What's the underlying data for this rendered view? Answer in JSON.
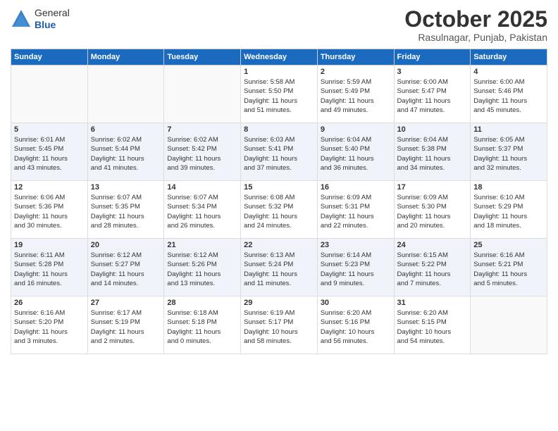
{
  "header": {
    "logo_general": "General",
    "logo_blue": "Blue",
    "month": "October 2025",
    "location": "Rasulnagar, Punjab, Pakistan"
  },
  "days_of_week": [
    "Sunday",
    "Monday",
    "Tuesday",
    "Wednesday",
    "Thursday",
    "Friday",
    "Saturday"
  ],
  "weeks": [
    [
      {
        "day": "",
        "info": ""
      },
      {
        "day": "",
        "info": ""
      },
      {
        "day": "",
        "info": ""
      },
      {
        "day": "1",
        "info": "Sunrise: 5:58 AM\nSunset: 5:50 PM\nDaylight: 11 hours\nand 51 minutes."
      },
      {
        "day": "2",
        "info": "Sunrise: 5:59 AM\nSunset: 5:49 PM\nDaylight: 11 hours\nand 49 minutes."
      },
      {
        "day": "3",
        "info": "Sunrise: 6:00 AM\nSunset: 5:47 PM\nDaylight: 11 hours\nand 47 minutes."
      },
      {
        "day": "4",
        "info": "Sunrise: 6:00 AM\nSunset: 5:46 PM\nDaylight: 11 hours\nand 45 minutes."
      }
    ],
    [
      {
        "day": "5",
        "info": "Sunrise: 6:01 AM\nSunset: 5:45 PM\nDaylight: 11 hours\nand 43 minutes."
      },
      {
        "day": "6",
        "info": "Sunrise: 6:02 AM\nSunset: 5:44 PM\nDaylight: 11 hours\nand 41 minutes."
      },
      {
        "day": "7",
        "info": "Sunrise: 6:02 AM\nSunset: 5:42 PM\nDaylight: 11 hours\nand 39 minutes."
      },
      {
        "day": "8",
        "info": "Sunrise: 6:03 AM\nSunset: 5:41 PM\nDaylight: 11 hours\nand 37 minutes."
      },
      {
        "day": "9",
        "info": "Sunrise: 6:04 AM\nSunset: 5:40 PM\nDaylight: 11 hours\nand 36 minutes."
      },
      {
        "day": "10",
        "info": "Sunrise: 6:04 AM\nSunset: 5:38 PM\nDaylight: 11 hours\nand 34 minutes."
      },
      {
        "day": "11",
        "info": "Sunrise: 6:05 AM\nSunset: 5:37 PM\nDaylight: 11 hours\nand 32 minutes."
      }
    ],
    [
      {
        "day": "12",
        "info": "Sunrise: 6:06 AM\nSunset: 5:36 PM\nDaylight: 11 hours\nand 30 minutes."
      },
      {
        "day": "13",
        "info": "Sunrise: 6:07 AM\nSunset: 5:35 PM\nDaylight: 11 hours\nand 28 minutes."
      },
      {
        "day": "14",
        "info": "Sunrise: 6:07 AM\nSunset: 5:34 PM\nDaylight: 11 hours\nand 26 minutes."
      },
      {
        "day": "15",
        "info": "Sunrise: 6:08 AM\nSunset: 5:32 PM\nDaylight: 11 hours\nand 24 minutes."
      },
      {
        "day": "16",
        "info": "Sunrise: 6:09 AM\nSunset: 5:31 PM\nDaylight: 11 hours\nand 22 minutes."
      },
      {
        "day": "17",
        "info": "Sunrise: 6:09 AM\nSunset: 5:30 PM\nDaylight: 11 hours\nand 20 minutes."
      },
      {
        "day": "18",
        "info": "Sunrise: 6:10 AM\nSunset: 5:29 PM\nDaylight: 11 hours\nand 18 minutes."
      }
    ],
    [
      {
        "day": "19",
        "info": "Sunrise: 6:11 AM\nSunset: 5:28 PM\nDaylight: 11 hours\nand 16 minutes."
      },
      {
        "day": "20",
        "info": "Sunrise: 6:12 AM\nSunset: 5:27 PM\nDaylight: 11 hours\nand 14 minutes."
      },
      {
        "day": "21",
        "info": "Sunrise: 6:12 AM\nSunset: 5:26 PM\nDaylight: 11 hours\nand 13 minutes."
      },
      {
        "day": "22",
        "info": "Sunrise: 6:13 AM\nSunset: 5:24 PM\nDaylight: 11 hours\nand 11 minutes."
      },
      {
        "day": "23",
        "info": "Sunrise: 6:14 AM\nSunset: 5:23 PM\nDaylight: 11 hours\nand 9 minutes."
      },
      {
        "day": "24",
        "info": "Sunrise: 6:15 AM\nSunset: 5:22 PM\nDaylight: 11 hours\nand 7 minutes."
      },
      {
        "day": "25",
        "info": "Sunrise: 6:16 AM\nSunset: 5:21 PM\nDaylight: 11 hours\nand 5 minutes."
      }
    ],
    [
      {
        "day": "26",
        "info": "Sunrise: 6:16 AM\nSunset: 5:20 PM\nDaylight: 11 hours\nand 3 minutes."
      },
      {
        "day": "27",
        "info": "Sunrise: 6:17 AM\nSunset: 5:19 PM\nDaylight: 11 hours\nand 2 minutes."
      },
      {
        "day": "28",
        "info": "Sunrise: 6:18 AM\nSunset: 5:18 PM\nDaylight: 11 hours\nand 0 minutes."
      },
      {
        "day": "29",
        "info": "Sunrise: 6:19 AM\nSunset: 5:17 PM\nDaylight: 10 hours\nand 58 minutes."
      },
      {
        "day": "30",
        "info": "Sunrise: 6:20 AM\nSunset: 5:16 PM\nDaylight: 10 hours\nand 56 minutes."
      },
      {
        "day": "31",
        "info": "Sunrise: 6:20 AM\nSunset: 5:15 PM\nDaylight: 10 hours\nand 54 minutes."
      },
      {
        "day": "",
        "info": ""
      }
    ]
  ]
}
